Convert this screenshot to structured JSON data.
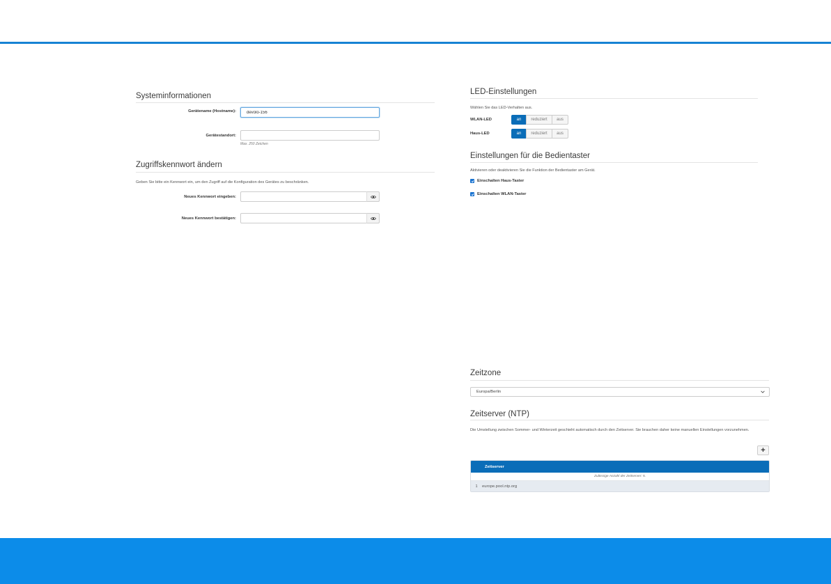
{
  "colors": {
    "accent_rule": "#1682d4",
    "footer": "#0c8ce9",
    "active_segment": "#0a6db8",
    "checkbox": "#1a73d0",
    "table_header": "#0a6db8"
  },
  "system_info": {
    "title": "Systeminformationen",
    "hostname_label": "Gerätename (Hostname):",
    "hostname_value": "devolo-156",
    "location_label": "Gerätestandort:",
    "location_value": "",
    "location_help": "Max. 250 Zeichen"
  },
  "password": {
    "title": "Zugriffskennwort ändern",
    "description": "Geben Sie bitte ein Kennwort ein, um den Zugriff auf die Konfiguration des Gerätes zu beschränken.",
    "new_label": "Neues Kennwort eingeben:",
    "confirm_label": "Neues Kennwort bestätigen:",
    "toggle_icon": "eye-icon"
  },
  "led": {
    "title": "LED-Einstellungen",
    "description": "Wählen Sie das LED-Verhalten aus.",
    "options": [
      "an",
      "reduziert",
      "aus"
    ],
    "rows": [
      {
        "label": "WLAN-LED",
        "selected": "an"
      },
      {
        "label": "Haus-LED",
        "selected": "an"
      }
    ]
  },
  "buttons_settings": {
    "title": "Einstellungen für die Bedientaster",
    "description": "Aktivieren oder deaktivieren Sie die Funktion der Bedientaster am Gerät.",
    "items": [
      {
        "label": "Einschalten Haus-Taster",
        "checked": true
      },
      {
        "label": "Einschalten WLAN-Taster",
        "checked": true
      }
    ]
  },
  "timezone": {
    "title": "Zeitzone",
    "selected": "Europa/Berlin"
  },
  "ntp": {
    "title": "Zeitserver (NTP)",
    "description": "Die Umstellung zwischen Sommer- und Winterzeit geschieht automatisch durch den Zeitserver. Sie brauchen daher keine manuellen Einstellungen vorzunehmen.",
    "add_label": "+",
    "table_header": "Zeitserver",
    "table_note": "Zulässige Anzahl der Zeitserver: 5.",
    "rows": [
      {
        "index": "1",
        "server": "europe.pool.ntp.org"
      }
    ]
  }
}
